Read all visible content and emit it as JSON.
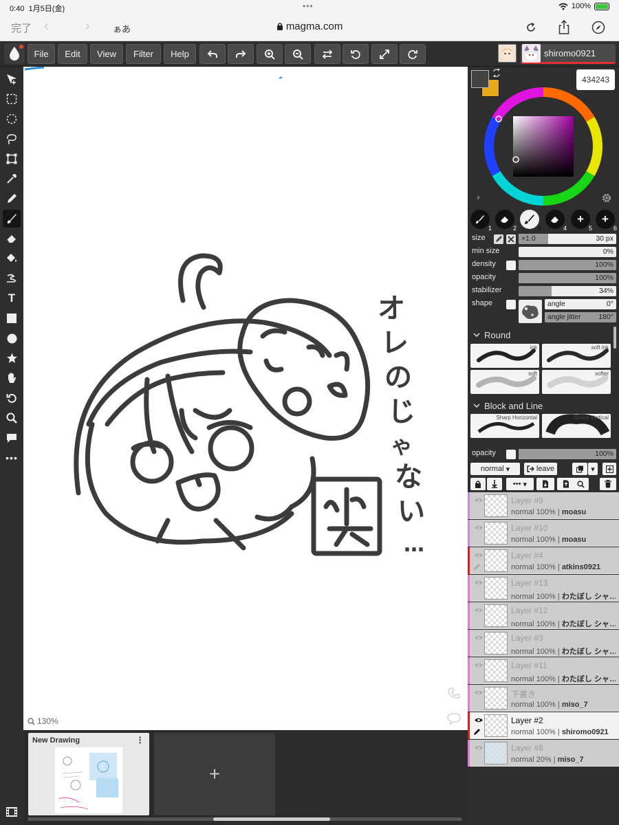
{
  "statusbar": {
    "time": "0:40",
    "date": "1月5日(金)",
    "battery": "100%"
  },
  "browser": {
    "done": "完了",
    "reader": "ぁあ",
    "url": "magma.com"
  },
  "menu": {
    "file": "File",
    "edit": "Edit",
    "view": "View",
    "filter": "Filter",
    "help": "Help"
  },
  "user": {
    "name": "shiromo0921"
  },
  "canvas": {
    "zoom": "130%"
  },
  "drawings": {
    "current_title": "New Drawing",
    "add_label": "+"
  },
  "color": {
    "hex": "434243",
    "primary": "#434243",
    "secondary": "#e5a91a"
  },
  "brush_slots": [
    "1",
    "2",
    "3",
    "4",
    "5",
    "6"
  ],
  "brush": {
    "size_label": "size",
    "size_multiplier": "×1.0",
    "size_value": "30 px",
    "min_size_label": "min size",
    "min_size_value": "0%",
    "density_label": "density",
    "density_value": "100%",
    "opacity_label": "opacity",
    "opacity_value": "100%",
    "stabilizer_label": "stabilizer",
    "stabilizer_value": "34%",
    "shape_label": "shape",
    "angle_label": "angle",
    "angle_value": "0°",
    "angle_jitter_label": "angle jitter",
    "angle_jitter_value": "180°"
  },
  "presets": {
    "round_title": "Round",
    "round": [
      "ink",
      "soft ink",
      "soft",
      "softer"
    ],
    "block_title": "Block and Line",
    "block": [
      "Sharp Horizontal",
      "Sharp Vertical"
    ]
  },
  "layer_controls": {
    "opacity_label": "opacity",
    "opacity_value": "100%",
    "blend_mode": "normal",
    "leave": "leave"
  },
  "layers": [
    {
      "name": "Layer #9",
      "mode": "normal",
      "opacity": "100%",
      "owner": "moasu",
      "color": "#c98be0"
    },
    {
      "name": "Layer #10",
      "mode": "normal",
      "opacity": "100%",
      "owner": "moasu",
      "color": "#c98be0"
    },
    {
      "name": "Layer #4",
      "mode": "normal",
      "opacity": "100%",
      "owner": "atkins0921",
      "color": "#d42020"
    },
    {
      "name": "Layer #13",
      "mode": "normal",
      "opacity": "100%",
      "owner": "わたぼし シャ…",
      "color": "#e07ad6"
    },
    {
      "name": "Layer #12",
      "mode": "normal",
      "opacity": "100%",
      "owner": "わたぼし シャ…",
      "color": "#e07ad6"
    },
    {
      "name": "Layer #3",
      "mode": "normal",
      "opacity": "100%",
      "owner": "わたぼし シャ…",
      "color": "#e07ad6"
    },
    {
      "name": "Layer #11",
      "mode": "normal",
      "opacity": "100%",
      "owner": "わたぼし シャ…",
      "color": "#e07ad6"
    },
    {
      "name": "下書き",
      "mode": "normal",
      "opacity": "100%",
      "owner": "miso_7",
      "color": "#e07ad6"
    },
    {
      "name": "Layer #2",
      "mode": "normal",
      "opacity": "100%",
      "owner": "shiromo0921",
      "color": "#d42020"
    },
    {
      "name": "Layer #8",
      "mode": "normal",
      "opacity": "20%",
      "owner": "miso_7",
      "color": "#e07ad6"
    }
  ]
}
